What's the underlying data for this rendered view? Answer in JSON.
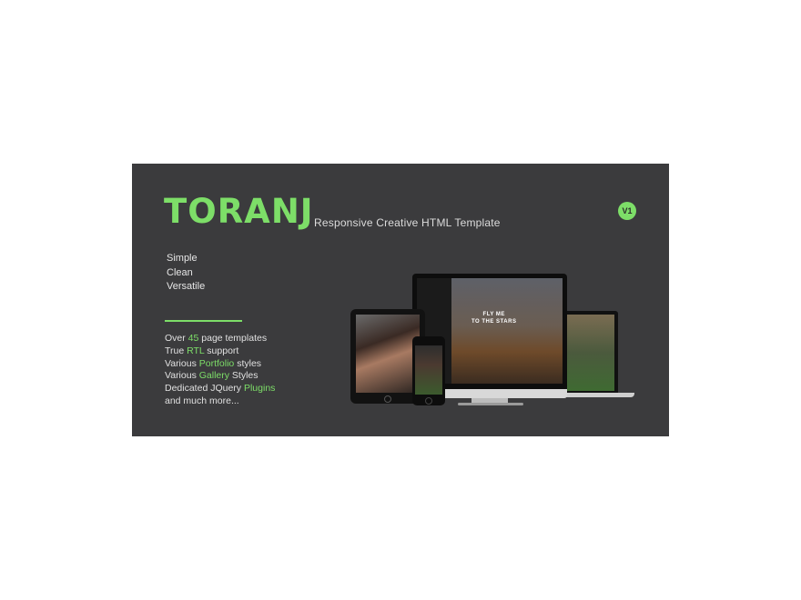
{
  "banner": {
    "logo": "TORANJ",
    "tagline": "Responsive Creative HTML Template",
    "version_badge": "V1",
    "keywords": [
      "Simple",
      "Clean",
      "Versatile"
    ],
    "features": [
      {
        "before": "Over ",
        "highlight": "45",
        "after": " page templates"
      },
      {
        "before": "True ",
        "highlight": "RTL",
        "after": " support"
      },
      {
        "before": "Various ",
        "highlight": "Portfolio",
        "after": " styles"
      },
      {
        "before": "Various ",
        "highlight": "Gallery",
        "after": " Styles"
      },
      {
        "before": "Dedicated JQuery ",
        "highlight": "Plugins",
        "after": ""
      },
      {
        "before": "and much more...",
        "highlight": "",
        "after": ""
      }
    ],
    "monitor_text": [
      "FLY ME",
      "TO THE STARS"
    ],
    "colors": {
      "accent": "#7dde68",
      "background": "#3b3b3d"
    }
  }
}
